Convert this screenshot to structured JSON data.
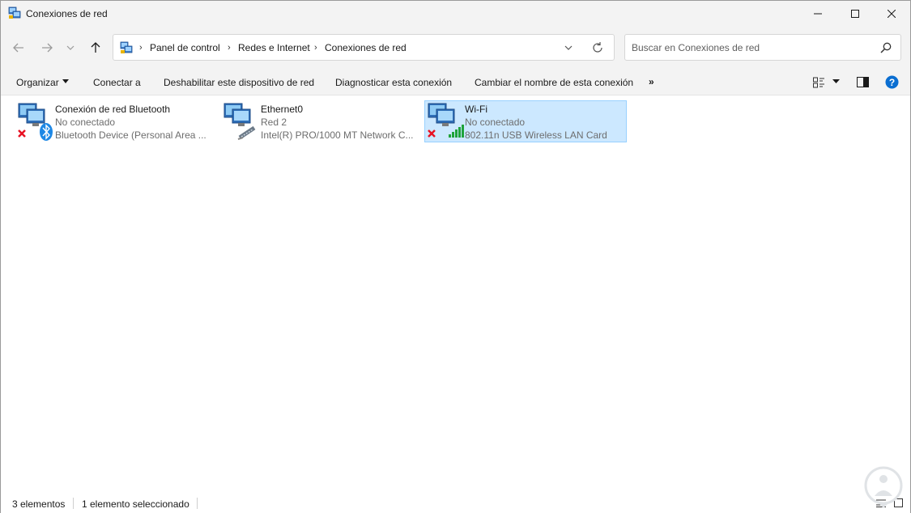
{
  "window": {
    "title": "Conexiones de red",
    "minimize_icon": "minimize-icon",
    "maximize_icon": "maximize-icon",
    "close_icon": "close-icon"
  },
  "nav": {
    "back_icon": "arrow-left-icon",
    "forward_icon": "arrow-right-icon",
    "recent_icon": "chevron-down-icon",
    "up_icon": "arrow-up-icon"
  },
  "address": {
    "breadcrumbs": [
      "Panel de control",
      "Redes e Internet",
      "Conexiones de red"
    ],
    "refresh_icon": "refresh-icon"
  },
  "search": {
    "placeholder": "Buscar en Conexiones de red",
    "value": ""
  },
  "commands": {
    "organize": "Organizar",
    "connect": "Conectar a",
    "disable": "Deshabilitar este dispositivo de red",
    "diagnose": "Diagnosticar esta conexión",
    "rename": "Cambiar el nombre de esta conexión",
    "more": "»"
  },
  "connections": [
    {
      "name": "Conexión de red Bluetooth",
      "status": "No conectado",
      "device": "Bluetooth Device (Personal Area ...",
      "icon": "bluetooth-network-icon",
      "selected": false
    },
    {
      "name": "Ethernet0",
      "status": "Red 2",
      "device": "Intel(R) PRO/1000 MT Network C...",
      "icon": "ethernet-network-icon",
      "selected": false
    },
    {
      "name": "Wi-Fi",
      "status": "No conectado",
      "device": "802.11n USB Wireless LAN Card",
      "icon": "wifi-network-icon",
      "selected": true
    }
  ],
  "statusbar": {
    "count": "3 elementos",
    "selection": "1 elemento seleccionado"
  },
  "colors": {
    "selection_bg": "#cce8ff",
    "selection_border": "#99d1ff",
    "help_blue": "#0a6ed1",
    "error_red": "#e81123",
    "signal_green": "#1fa33b"
  }
}
